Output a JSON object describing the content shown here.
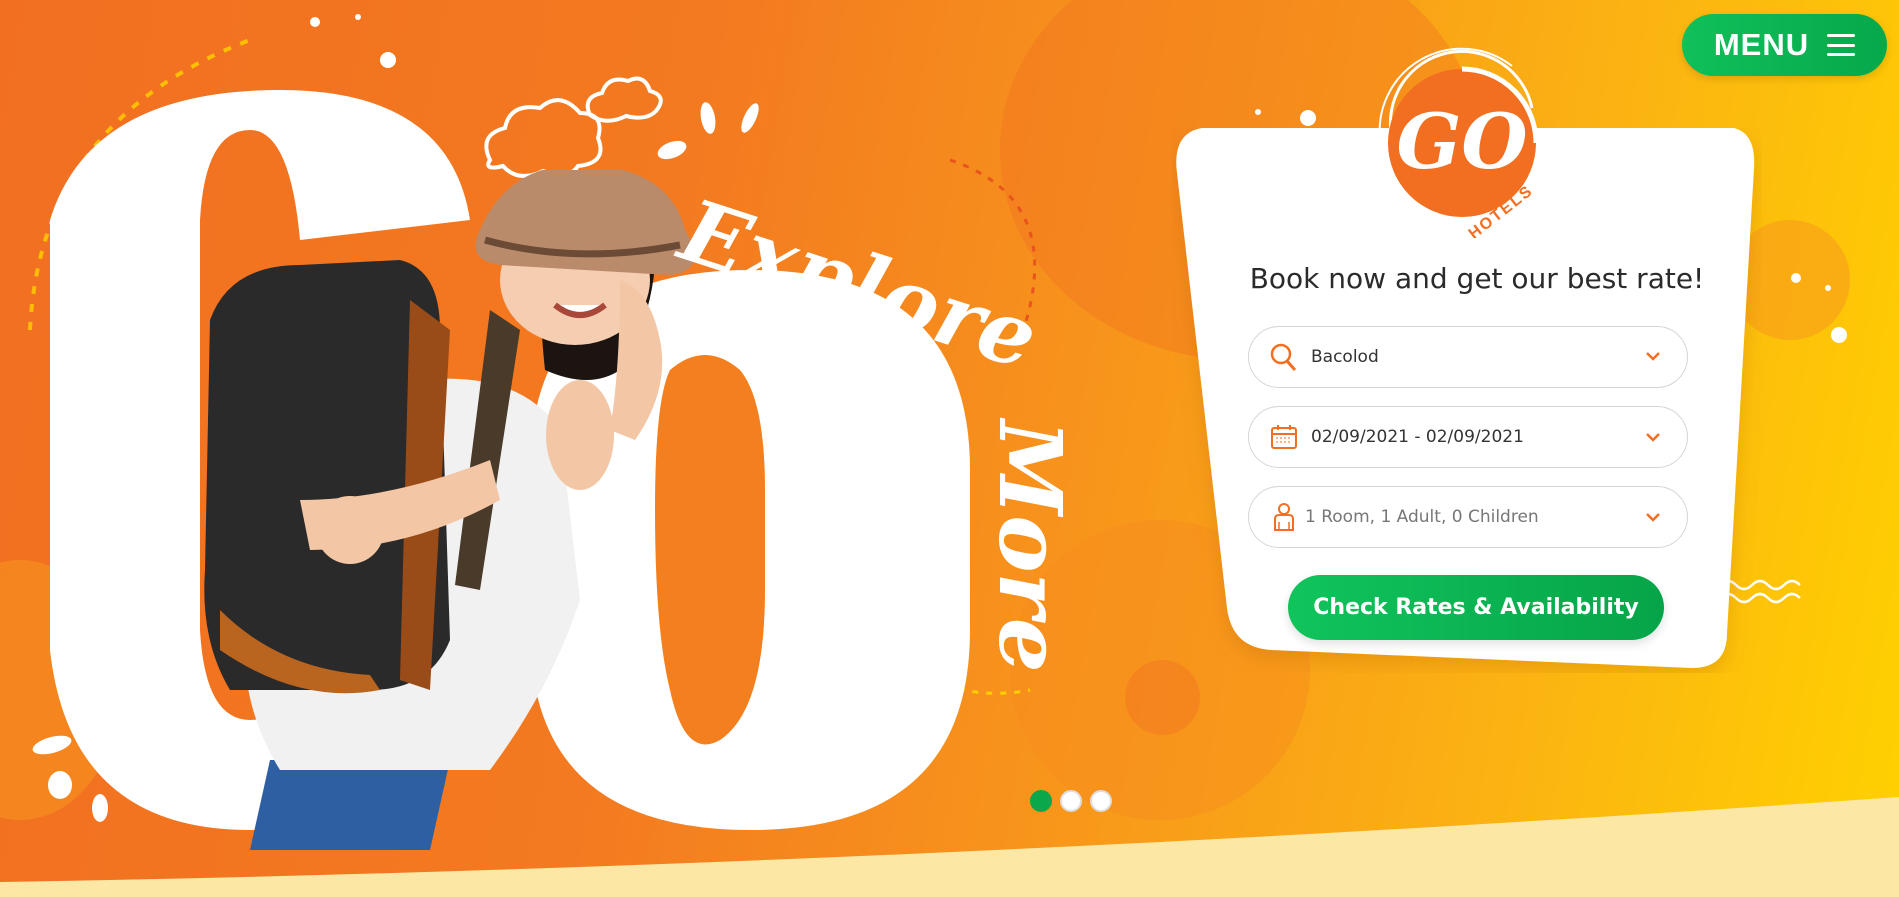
{
  "brand": {
    "logo_text": "GO",
    "logo_subtext": "HOTELS"
  },
  "hero": {
    "big_text": "GO",
    "script_text_line1": "Explore",
    "script_text_line2": "More"
  },
  "menu": {
    "label": "MENU"
  },
  "booking": {
    "headline": "Book now and get our best rate!",
    "destination": {
      "value": "Bacolod"
    },
    "dates": {
      "value": "02/09/2021 - 02/09/2021"
    },
    "guests": {
      "value": "1 Room, 1 Adult, 0 Children"
    },
    "cta_label": "Check Rates & Availability"
  },
  "carousel": {
    "slides": 3,
    "active_index": 0
  },
  "colors": {
    "orange": "#f26f21",
    "yellow": "#ffd100",
    "green": "#0aa84a",
    "cream": "#fde7a4"
  },
  "icons": {
    "destination": "search-icon",
    "dates": "calendar-icon",
    "guests": "person-icon",
    "dropdown": "chevron-down-icon",
    "menu": "hamburger-icon"
  }
}
